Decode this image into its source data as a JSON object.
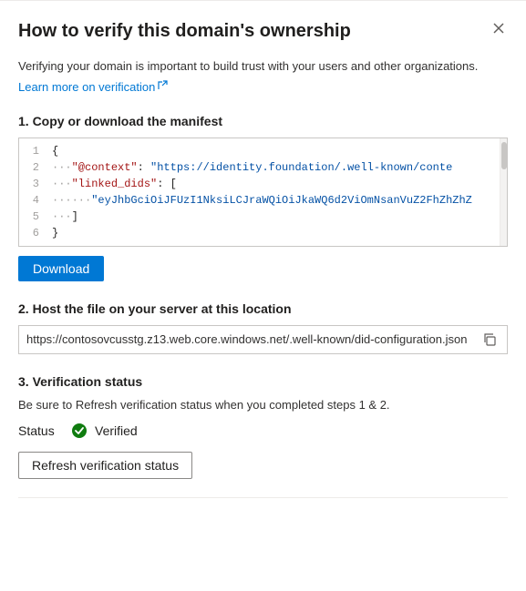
{
  "panel": {
    "title": "How to verify this domain's ownership",
    "close_label": "×"
  },
  "intro": {
    "description": "Verifying your domain is important to build trust with your users and other organizations.",
    "learn_more_text": "Learn more on verification",
    "learn_more_url": "#"
  },
  "step1": {
    "title": "1. Copy or download the manifest",
    "code_lines": [
      {
        "num": "1",
        "content": "{"
      },
      {
        "num": "2",
        "content": "  \"@context\":  \"https://identity.foundation/.well-known/conte"
      },
      {
        "num": "3",
        "content": "  \"linked_dids\": ["
      },
      {
        "num": "4",
        "content": "    \"eyJhbGciOiJFUzI1NksiLCJraWQiOiJkaWQ6d2ViOmNsanVuZ2FhZhZh"
      },
      {
        "num": "5",
        "content": "  ]"
      },
      {
        "num": "6",
        "content": "}"
      }
    ],
    "download_label": "Download"
  },
  "step2": {
    "title": "2. Host the file on your server at this location",
    "url": "https://contosovcusstg.z13.web.core.windows.net/.well-known/did-configuration.json",
    "copy_tooltip": "Copy"
  },
  "step3": {
    "title": "3. Verification status",
    "description": "Be sure to Refresh verification status when you completed steps 1 & 2.",
    "status_label": "Status",
    "status_value": "Verified",
    "refresh_label": "Refresh verification status"
  }
}
